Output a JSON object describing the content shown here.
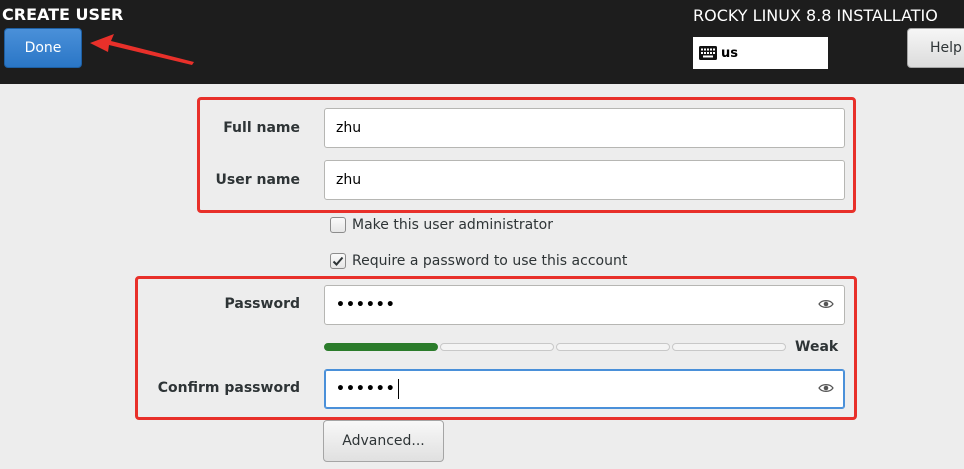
{
  "header": {
    "title": "CREATE USER",
    "done_label": "Done",
    "install_title": "ROCKY LINUX 8.8 INSTALLATIO",
    "keyboard_layout": "us",
    "help_label": "Help"
  },
  "form": {
    "full_name_label": "Full name",
    "full_name_value": "zhu",
    "user_name_label": "User name",
    "user_name_value": "zhu",
    "admin_checkbox_label": "Make this user administrator",
    "admin_checked": false,
    "require_password_label": "Require a password to use this account",
    "require_password_checked": true,
    "password_label": "Password",
    "password_mask": "••••••",
    "confirm_password_label": "Confirm password",
    "confirm_password_mask": "••••••",
    "strength_level": 0.25,
    "strength_label": "Weak",
    "advanced_label": "Advanced..."
  },
  "colors": {
    "topbar": "#1d1d1d",
    "done_button": "#2a76c6",
    "strength_fill": "#2b7c2b",
    "annotation": "#e8302a"
  }
}
